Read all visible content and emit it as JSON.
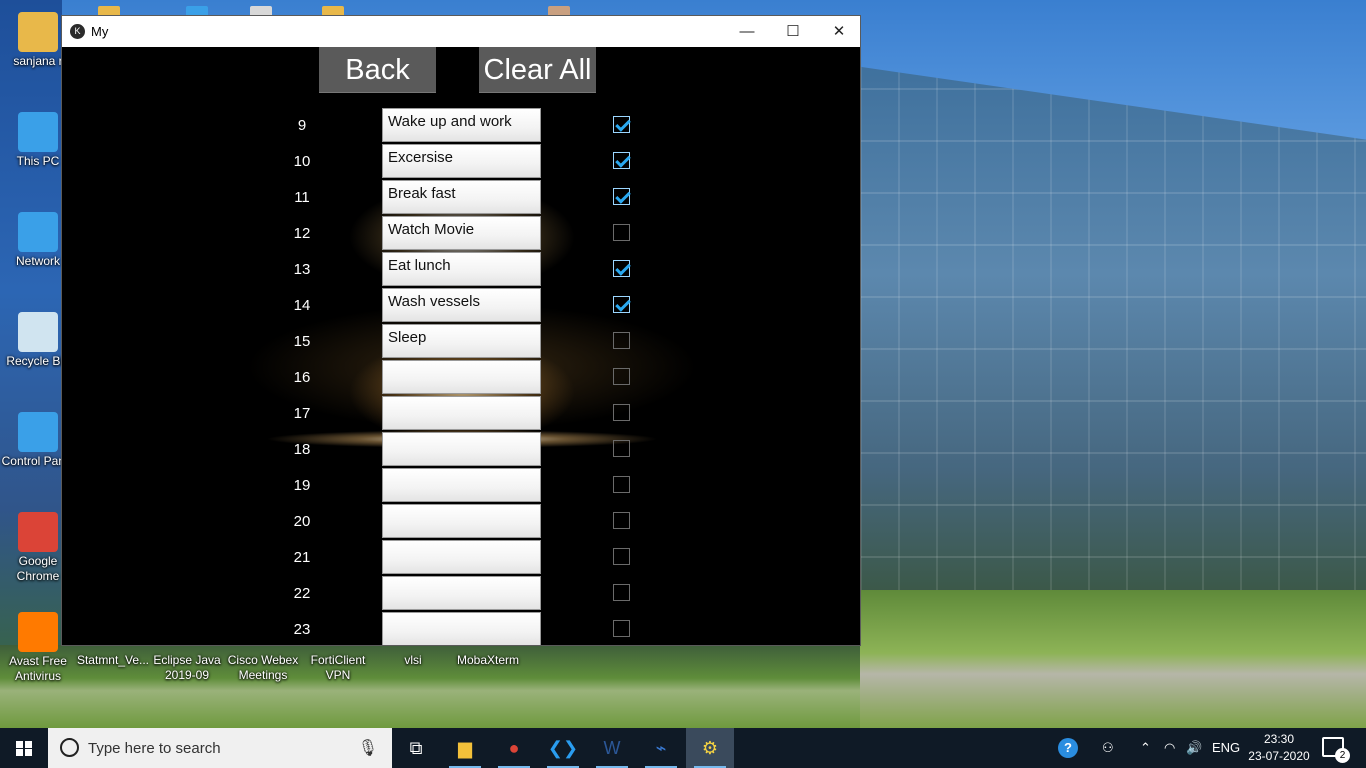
{
  "desktop": {
    "icons": [
      {
        "label": "sanjana r",
        "icon": "user-folder-icon",
        "color": "#e8b84a"
      },
      {
        "label": "This PC",
        "icon": "computer-icon",
        "color": "#3aa0e8"
      },
      {
        "label": "Network",
        "icon": "network-icon",
        "color": "#3aa0e8"
      },
      {
        "label": "Recycle Bin",
        "icon": "recycle-bin-icon",
        "color": "#d0e4f0"
      },
      {
        "label": "Control Panel",
        "icon": "control-panel-icon",
        "color": "#3aa0e8"
      },
      {
        "label": "Google Chrome",
        "icon": "chrome-icon",
        "color": "#db4437"
      },
      {
        "label": "Avast Free Antivirus",
        "icon": "avast-icon",
        "color": "#ff7a00"
      }
    ],
    "bottom_icons": [
      {
        "label": "Statmnt_Ve..."
      },
      {
        "label": "Eclipse Java 2019-09"
      },
      {
        "label": "Cisco Webex Meetings"
      },
      {
        "label": "FortiClient VPN"
      },
      {
        "label": "vlsi"
      },
      {
        "label": "MobaXterm"
      }
    ]
  },
  "window": {
    "title": "My",
    "minimize": "—",
    "maximize": "☐",
    "close": "✕"
  },
  "app": {
    "back_label": "Back",
    "clear_label": "Clear All",
    "rows": [
      {
        "hour": "9",
        "task": "Wake up and work",
        "done": true
      },
      {
        "hour": "10",
        "task": "Excersise",
        "done": true
      },
      {
        "hour": "11",
        "task": "Break fast",
        "done": true
      },
      {
        "hour": "12",
        "task": "Watch Movie",
        "done": false
      },
      {
        "hour": "13",
        "task": "Eat lunch",
        "done": true
      },
      {
        "hour": "14",
        "task": "Wash vessels",
        "done": true
      },
      {
        "hour": "15",
        "task": "Sleep",
        "done": false
      },
      {
        "hour": "16",
        "task": "",
        "done": false
      },
      {
        "hour": "17",
        "task": "",
        "done": false
      },
      {
        "hour": "18",
        "task": "",
        "done": false
      },
      {
        "hour": "19",
        "task": "",
        "done": false
      },
      {
        "hour": "20",
        "task": "",
        "done": false
      },
      {
        "hour": "21",
        "task": "",
        "done": false
      },
      {
        "hour": "22",
        "task": "",
        "done": false
      },
      {
        "hour": "23",
        "task": "",
        "done": false
      }
    ]
  },
  "taskbar": {
    "search_placeholder": "Type here to search",
    "apps": [
      {
        "name": "task-view-icon",
        "glyph": "⧉"
      },
      {
        "name": "file-explorer-icon",
        "glyph": "▆"
      },
      {
        "name": "chrome-icon",
        "glyph": "●"
      },
      {
        "name": "vscode-icon",
        "glyph": "❮❯"
      },
      {
        "name": "word-icon",
        "glyph": "W"
      },
      {
        "name": "mobaxterm-icon",
        "glyph": "⌁"
      },
      {
        "name": "python-icon",
        "glyph": "⚙"
      }
    ],
    "language": "ENG",
    "time": "23:30",
    "date": "23-07-2020",
    "notifications": "2"
  }
}
